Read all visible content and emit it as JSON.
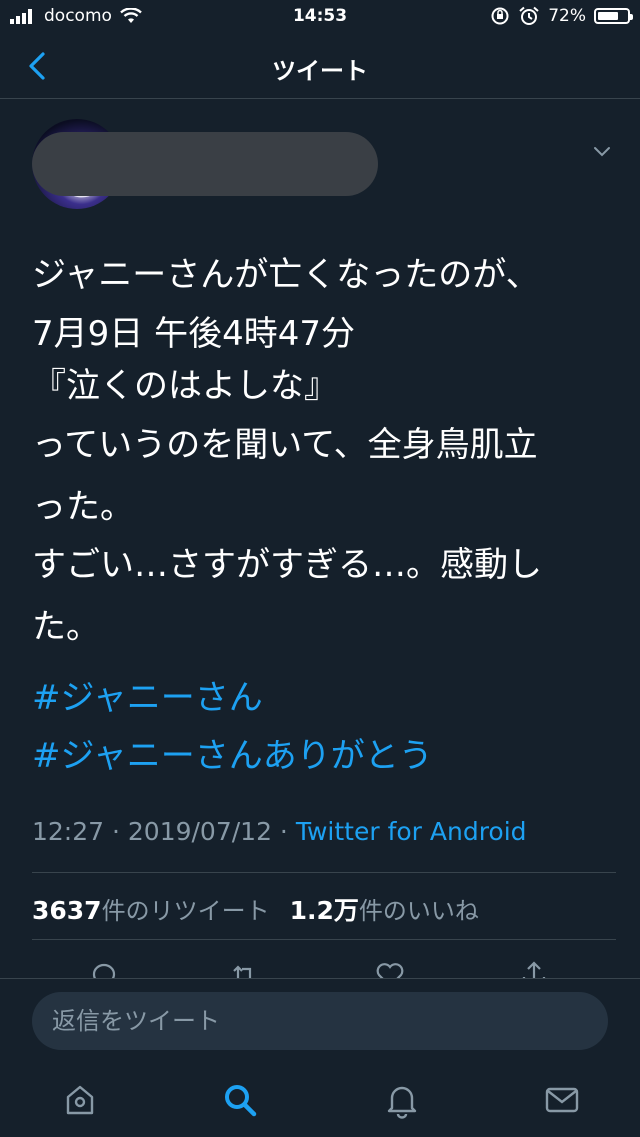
{
  "status_bar": {
    "carrier": "docomo",
    "time": "14:53",
    "battery_percent": "72%",
    "battery_level": 0.72
  },
  "header": {
    "title": "ツイート",
    "back_icon": "chevron-left-icon"
  },
  "tweet": {
    "text_lines": [
      "ジャニーさんが亡くなったのが、",
      "7月9日 午後4時47分",
      "『泣くのはよしな』",
      "っていうのを聞いて、全身鳥肌立",
      "った。",
      "すごい…さすがすぎる…。感動し",
      "た。"
    ],
    "hashtags": [
      "#ジャニーさん",
      "#ジャニーさんありがとう"
    ],
    "timestamp": "12:27 · 2019/07/12 · ",
    "source": "Twitter for Android",
    "retweet_count": "3637",
    "retweet_label": "件のリツイート",
    "like_count": "1.2万",
    "like_label": "件のいいね"
  },
  "reply": {
    "placeholder": "返信をツイート"
  },
  "tabs": [
    "home-icon",
    "search-icon",
    "notifications-icon",
    "messages-icon"
  ],
  "colors": {
    "background": "#15202b",
    "accent": "#1da1f2",
    "muted": "#8899a6",
    "divider": "#38444d"
  }
}
